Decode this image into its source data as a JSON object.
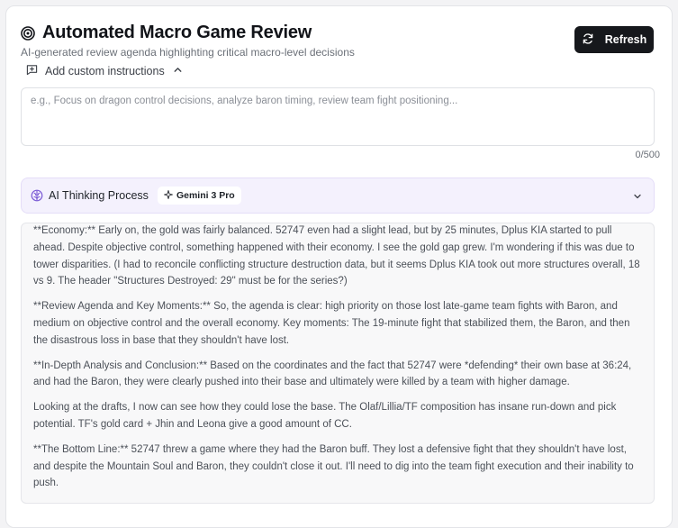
{
  "header": {
    "title": "Automated Macro Game Review",
    "subtitle": "AI-generated review agenda highlighting critical macro-level decisions",
    "title_icon": "target-icon"
  },
  "refresh_button": {
    "label": "Refresh",
    "icon": "refresh-icon"
  },
  "instructions": {
    "toggle_label": "Add custom instructions",
    "toggle_icon": "message-plus-icon",
    "expanded": true,
    "placeholder": "e.g., Focus on dragon control decisions, analyze baron timing, review team fight positioning...",
    "value": "",
    "counter": "0/500"
  },
  "thinking": {
    "label": "AI Thinking Process",
    "model_badge": "Gemini 3 Pro",
    "collapsed": false,
    "paragraphs": [
      "**Economy:** Early on, the gold was fairly balanced. 52747 even had a slight lead, but by 25 minutes, Dplus KIA started to pull ahead. Despite objective control, something happened with their economy. I see the gold gap grew. I'm wondering if this was due to tower disparities. (I had to reconcile conflicting structure destruction data, but it seems Dplus KIA took out more structures overall, 18 vs 9. The header \"Structures Destroyed: 29\" must be for the series?)",
      "**Review Agenda and Key Moments:** So, the agenda is clear: high priority on those lost late-game team fights with Baron, and medium on objective control and the overall economy. Key moments: The 19-minute fight that stabilized them, the Baron, and then the disastrous loss in base that they shouldn't have lost.",
      "**In-Depth Analysis and Conclusion:** Based on the coordinates and the fact that 52747 were *defending* their own base at 36:24, and had the Baron, they were clearly pushed into their base and ultimately were killed by a team with higher damage.",
      "Looking at the drafts, I now can see how they could lose the base. The Olaf/Lillia/TF composition has insane run-down and pick potential. TF's gold card + Jhin and Leona give a good amount of CC.",
      "**The Bottom Line:** 52747 threw a game where they had the Baron buff. They lost a defensive fight that they shouldn't have lost, and despite the Mountain Soul and Baron, they couldn't close it out. I'll need to dig into the team fight execution and their inability to push."
    ]
  },
  "colors": {
    "accent_purple": "#7c5cd6",
    "thinking_bg": "#f4f1fd",
    "button_bg": "#16181c"
  }
}
